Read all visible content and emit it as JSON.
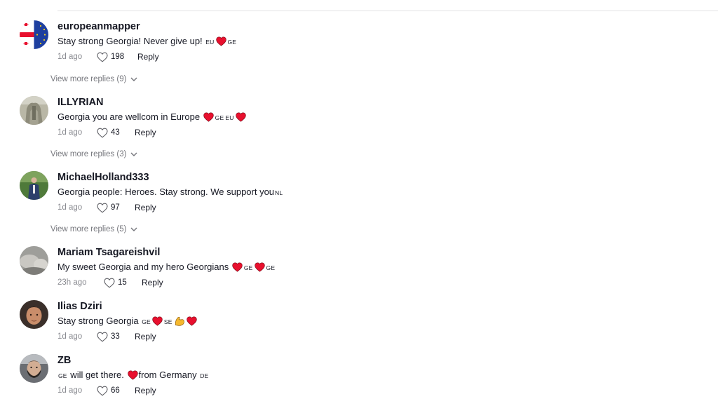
{
  "comments": [
    {
      "username": "europeanmapper",
      "segments": [
        {
          "type": "text",
          "value": "Stay strong Georgia! Never give up! "
        },
        {
          "type": "code",
          "value": "EU"
        },
        {
          "type": "heart"
        },
        {
          "type": "code",
          "value": "GE"
        }
      ],
      "time": "1d ago",
      "likes": "198",
      "reply": "Reply",
      "avatar": "georgia-eu-flag"
    },
    {
      "username": "ILLYRIAN",
      "segments": [
        {
          "type": "text",
          "value": "Georgia you are wellcom in Europe "
        },
        {
          "type": "heart"
        },
        {
          "type": "code",
          "value": "GE"
        },
        {
          "type": "code",
          "value": "EU"
        },
        {
          "type": "heart"
        }
      ],
      "time": "1d ago",
      "likes": "43",
      "reply": "Reply",
      "avatar": "statue-photo"
    },
    {
      "username": "MichaelHolland333",
      "segments": [
        {
          "type": "text",
          "value": "Georgia people: Heroes. Stay strong. We support you"
        },
        {
          "type": "code",
          "value": "NL"
        }
      ],
      "time": "1d ago",
      "likes": "97",
      "reply": "Reply",
      "avatar": "man-suit-photo"
    },
    {
      "username": "Mariam Tsagareishvil",
      "segments": [
        {
          "type": "text",
          "value": "My sweet Georgia and my hero Georgians "
        },
        {
          "type": "heart"
        },
        {
          "type": "code",
          "value": "GE"
        },
        {
          "type": "heart"
        },
        {
          "type": "code",
          "value": "GE"
        }
      ],
      "time": "23h ago",
      "likes": "15",
      "reply": "Reply",
      "avatar": "blurred-photo"
    },
    {
      "username": "Ilias Dziri",
      "segments": [
        {
          "type": "text",
          "value": "Stay strong Georgia "
        },
        {
          "type": "code",
          "value": "GE"
        },
        {
          "type": "heart"
        },
        {
          "type": "code",
          "value": "SE"
        },
        {
          "type": "muscle"
        },
        {
          "type": "heart"
        }
      ],
      "time": "1d ago",
      "likes": "33",
      "reply": "Reply",
      "avatar": "face-photo"
    },
    {
      "username": "ZB",
      "segments": [
        {
          "type": "code",
          "value": "GE"
        },
        {
          "type": "text",
          "value": " will get there. "
        },
        {
          "type": "heart"
        },
        {
          "type": "text",
          "value": "from Germany "
        },
        {
          "type": "code",
          "value": "DE"
        }
      ],
      "time": "1d ago",
      "likes": "66",
      "reply": "Reply",
      "avatar": "bearded-man-photo"
    }
  ],
  "view_more": [
    {
      "label": "View more replies (9)"
    },
    {
      "label": "View more replies (3)"
    },
    {
      "label": "View more replies (5)"
    }
  ],
  "colors": {
    "heart": "#e8102e",
    "muscle": "#f5b82e",
    "muted": "#8a8b91",
    "text": "#161823"
  }
}
